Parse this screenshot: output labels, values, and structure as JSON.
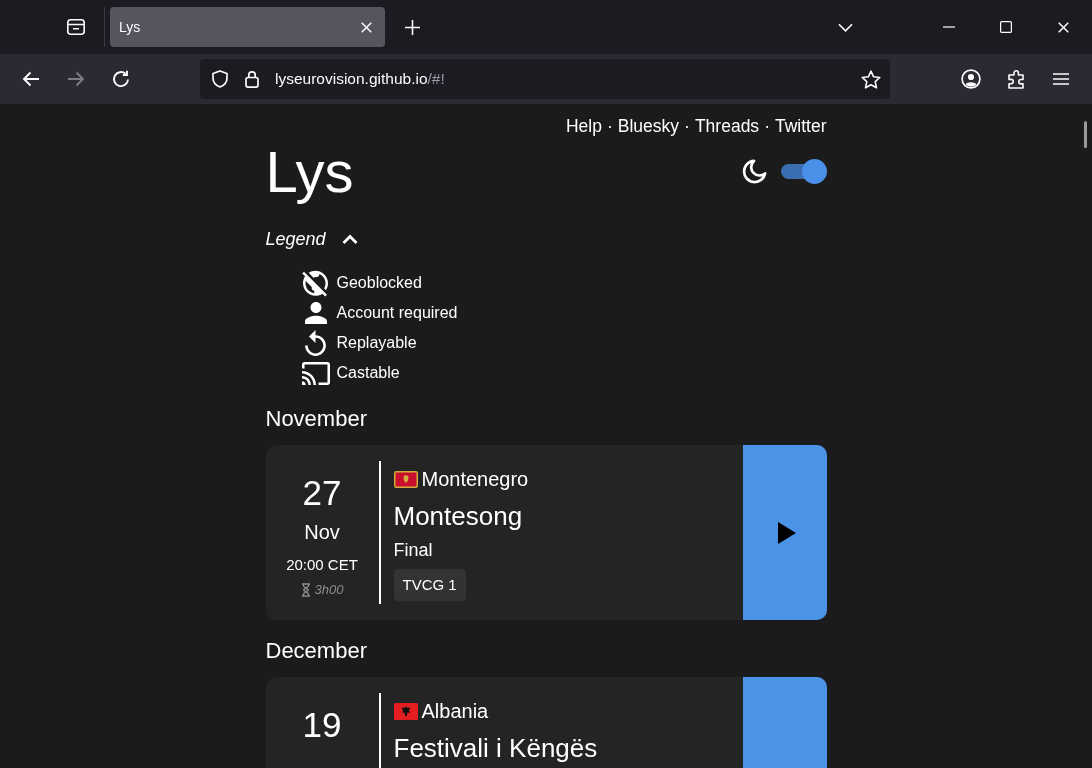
{
  "browser": {
    "tabs": [
      {
        "title": "Lys",
        "selected": true
      }
    ],
    "nav_buttons": [
      {
        "kind": "back",
        "disabled": false
      },
      {
        "kind": "forward",
        "disabled": true
      },
      {
        "kind": "reload",
        "disabled": false
      }
    ],
    "address": {
      "host": "lyseurovision.github.io",
      "path": "/#!"
    }
  },
  "header": {
    "links": [
      "Help",
      "Bluesky",
      "Threads",
      "Twitter"
    ],
    "separator": "·",
    "title": "Lys",
    "dark_mode": {
      "on": true
    }
  },
  "legend": {
    "label": "Legend",
    "expanded": true,
    "items": [
      {
        "kind": "geoblocked",
        "label": "Geoblocked"
      },
      {
        "kind": "account",
        "label": "Account required"
      },
      {
        "kind": "replay",
        "label": "Replayable"
      },
      {
        "kind": "cast",
        "label": "Castable"
      }
    ]
  },
  "months": [
    {
      "name": "November",
      "events": [
        {
          "day": "27",
          "month": "Nov",
          "time": "20:00 CET",
          "duration": "3h00",
          "country": {
            "name": "Montenegro",
            "kind": "me"
          },
          "title": "Montesong",
          "stage": "Final",
          "channels": [
            "TVCG 1"
          ]
        }
      ]
    },
    {
      "name": "December",
      "events": [
        {
          "day": "19",
          "country": {
            "name": "Albania",
            "kind": "al"
          },
          "title": "Festivali i Këngës"
        }
      ]
    }
  ]
}
